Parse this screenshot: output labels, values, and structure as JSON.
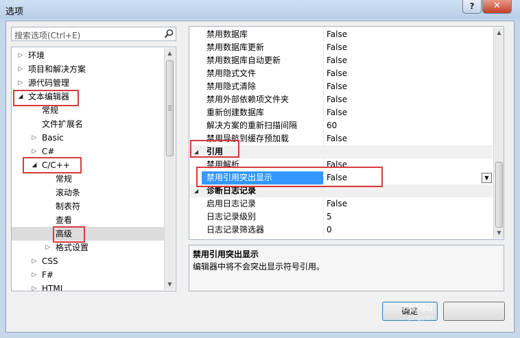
{
  "window": {
    "title": "选项"
  },
  "search": {
    "placeholder": "搜索选项(Ctrl+E)"
  },
  "tree": {
    "items": [
      {
        "label": "环境",
        "level": 0,
        "state": "collapsed"
      },
      {
        "label": "项目和解决方案",
        "level": 0,
        "state": "collapsed"
      },
      {
        "label": "源代码管理",
        "level": 0,
        "state": "collapsed"
      },
      {
        "label": "文本编辑器",
        "level": 0,
        "state": "expanded"
      },
      {
        "label": "常规",
        "level": 1,
        "state": "leaf"
      },
      {
        "label": "文件扩展名",
        "level": 1,
        "state": "leaf"
      },
      {
        "label": "Basic",
        "level": 1,
        "state": "collapsed"
      },
      {
        "label": "C#",
        "level": 1,
        "state": "collapsed"
      },
      {
        "label": "C/C++",
        "level": 1,
        "state": "expanded"
      },
      {
        "label": "常规",
        "level": 2,
        "state": "leaf"
      },
      {
        "label": "滚动条",
        "level": 2,
        "state": "leaf"
      },
      {
        "label": "制表符",
        "level": 2,
        "state": "leaf"
      },
      {
        "label": "查看",
        "level": 2,
        "state": "leaf"
      },
      {
        "label": "高级",
        "level": 2,
        "state": "leaf",
        "selected": true
      },
      {
        "label": "格式设置",
        "level": 2,
        "state": "collapsed"
      },
      {
        "label": "CSS",
        "level": 1,
        "state": "collapsed"
      },
      {
        "label": "F#",
        "level": 1,
        "state": "collapsed"
      },
      {
        "label": "HTML",
        "level": 1,
        "state": "collapsed"
      }
    ]
  },
  "grid": {
    "rows": [
      {
        "type": "prop",
        "name": "禁用数据库",
        "value": "False"
      },
      {
        "type": "prop",
        "name": "禁用数据库更新",
        "value": "False"
      },
      {
        "type": "prop",
        "name": "禁用数据库自动更新",
        "value": "False"
      },
      {
        "type": "prop",
        "name": "禁用隐式文件",
        "value": "False"
      },
      {
        "type": "prop",
        "name": "禁用隐式清除",
        "value": "False"
      },
      {
        "type": "prop",
        "name": "禁用外部依赖项文件夹",
        "value": "False"
      },
      {
        "type": "prop",
        "name": "重新创建数据库",
        "value": "False"
      },
      {
        "type": "prop",
        "name": "解决方案的重新扫描间隔",
        "value": "60"
      },
      {
        "type": "prop",
        "name": "禁用导航到缓存预加载",
        "value": "False"
      },
      {
        "type": "cat",
        "name": "引用"
      },
      {
        "type": "prop",
        "name": "禁用解析",
        "value": "False"
      },
      {
        "type": "prop",
        "name": "禁用引用突出显示",
        "value": "False",
        "selected": true
      },
      {
        "type": "cat",
        "name": "诊断日志记录"
      },
      {
        "type": "prop",
        "name": "启用日志记录",
        "value": "False"
      },
      {
        "type": "prop",
        "name": "日志记录级别",
        "value": "5"
      },
      {
        "type": "prop",
        "name": "日志记录筛选器",
        "value": "0"
      }
    ]
  },
  "description": {
    "title": "禁用引用突出显示",
    "text": "编辑器中将不会突出显示符号引用。"
  },
  "buttons": {
    "ok": "确定",
    "cancel": ""
  },
  "watermark": {
    "line1": "Baidu",
    "line2": "jingyan"
  },
  "colors": {
    "highlight_box": "#d83a3a",
    "selection": "#3399ff",
    "title_bar": "#c7d7ea"
  }
}
